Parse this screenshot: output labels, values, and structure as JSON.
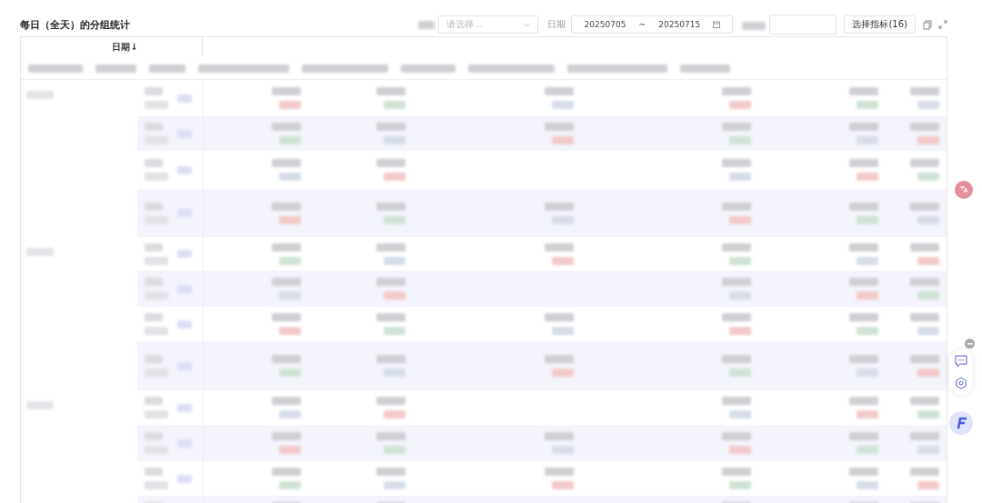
{
  "title": "每日（全天）的分组统计",
  "toolbar": {
    "select": {
      "placeholder": "请选择..."
    },
    "date_label": "日期",
    "date_start": "20250705",
    "date_separator": "~",
    "date_end": "20250715",
    "metrics_button": "选择指标(16)"
  },
  "table": {
    "columns": [
      {
        "label": "日期↓"
      }
    ]
  }
}
